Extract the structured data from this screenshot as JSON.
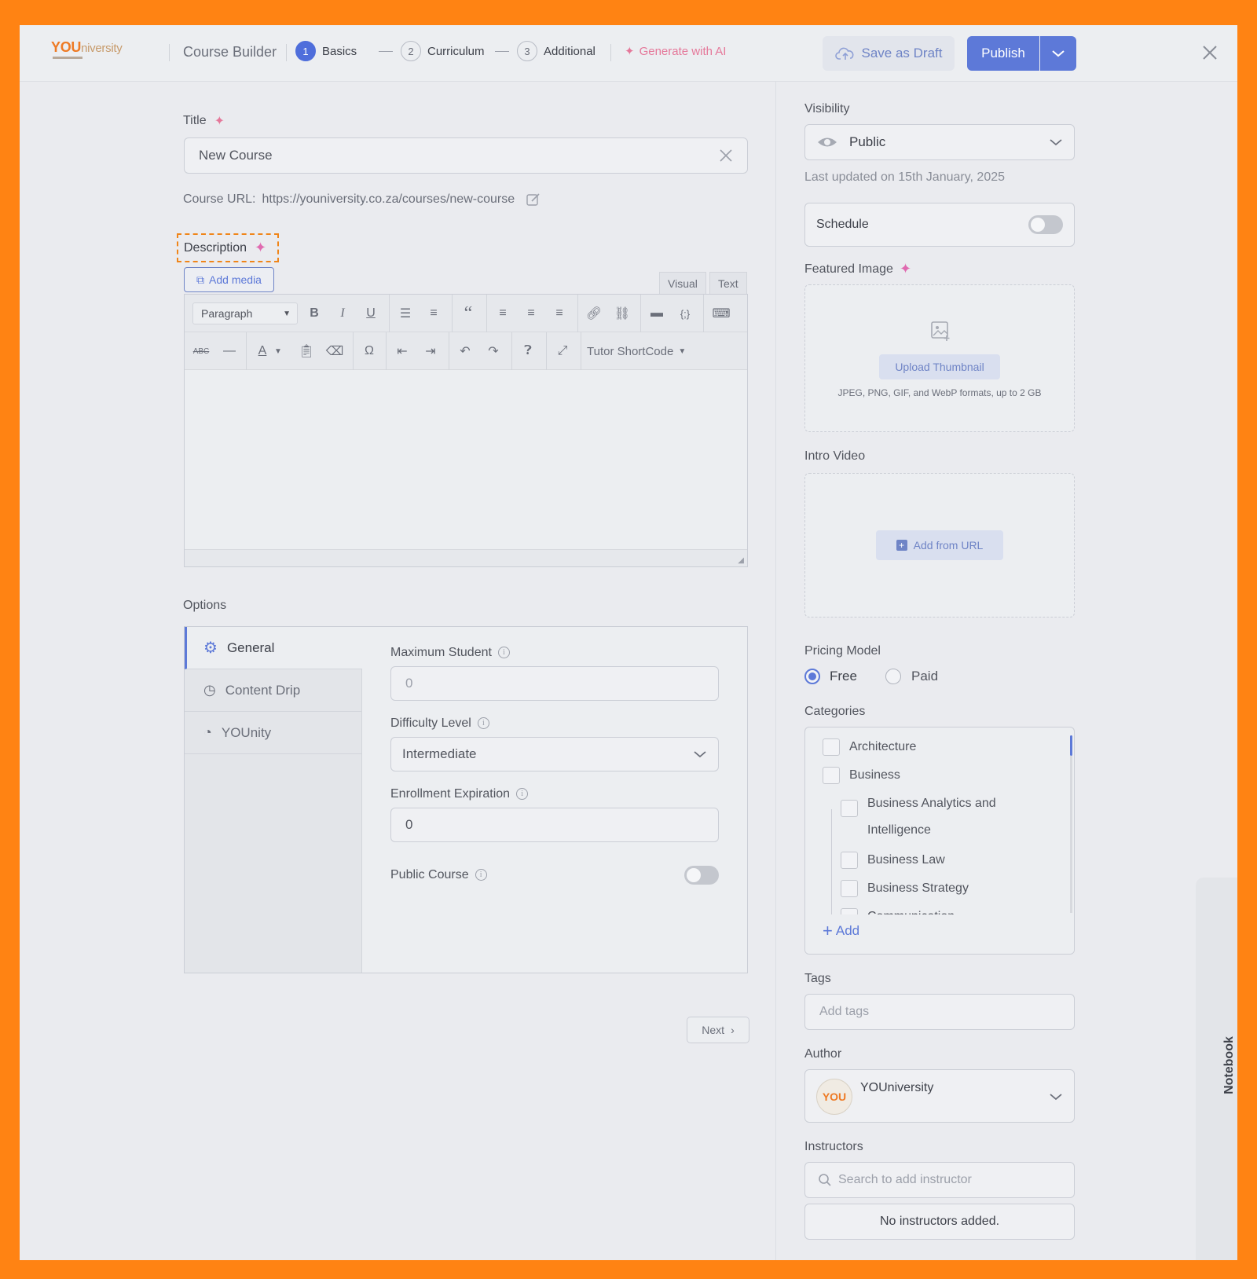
{
  "header": {
    "logo_main": "YOU",
    "logo_rest": "niversity",
    "title": "Course Builder",
    "steps": [
      {
        "num": "1",
        "label": "Basics"
      },
      {
        "num": "2",
        "label": "Curriculum"
      },
      {
        "num": "3",
        "label": "Additional"
      }
    ],
    "generate_ai": "Generate with AI",
    "save_draft": "Save as Draft",
    "publish": "Publish"
  },
  "main": {
    "title_label": "Title",
    "title_value": "New Course",
    "course_url_label": "Course URL:",
    "course_url_value": "https://youniversity.co.za/courses/new-course",
    "description_label": "Description",
    "add_media": "Add media",
    "tab_visual": "Visual",
    "tab_text": "Text",
    "paragraph_select": "Paragraph",
    "shortcode": "Tutor ShortCode",
    "options_label": "Options",
    "option_tabs": [
      "General",
      "Content Drip",
      "YOUnity"
    ],
    "max_student_label": "Maximum Student",
    "max_student_placeholder": "0",
    "difficulty_label": "Difficulty Level",
    "difficulty_value": "Intermediate",
    "enroll_exp_label": "Enrollment Expiration",
    "enroll_exp_value": "0",
    "public_course_label": "Public Course",
    "next_button": "Next"
  },
  "sidebar": {
    "visibility_label": "Visibility",
    "visibility_value": "Public",
    "last_updated": "Last updated on 15th January, 2025",
    "schedule_label": "Schedule",
    "featured_image_label": "Featured Image",
    "upload_thumbnail": "Upload Thumbnail",
    "upload_hint": "JPEG, PNG, GIF, and WebP formats, up to 2 GB",
    "intro_video_label": "Intro Video",
    "add_from_url": "Add from URL",
    "pricing_label": "Pricing Model",
    "pricing_free": "Free",
    "pricing_paid": "Paid",
    "pricing_selected": "Free",
    "categories_label": "Categories",
    "categories": [
      {
        "label": "Architecture",
        "level": 0
      },
      {
        "label": "Business",
        "level": 0
      },
      {
        "label": "Business Analytics and Intelligence",
        "level": 1
      },
      {
        "label": "Business Law",
        "level": 1
      },
      {
        "label": "Business Strategy",
        "level": 1
      },
      {
        "label": "Communication",
        "level": 1
      }
    ],
    "add_category": "Add",
    "tags_label": "Tags",
    "tags_placeholder": "Add tags",
    "author_label": "Author",
    "author_name": "YOUniversity",
    "author_avatar": "YOU",
    "instructors_label": "Instructors",
    "instructors_placeholder": "Search to add instructor",
    "no_instructors": "No instructors added.",
    "notebook": "Notebook"
  },
  "colors": {
    "accent": "#5d79d8",
    "ai_pink": "#e5789a",
    "brand_orange": "#ee7a24",
    "border_frame": "#ff8313",
    "highlight_dashed": "#f08519"
  }
}
